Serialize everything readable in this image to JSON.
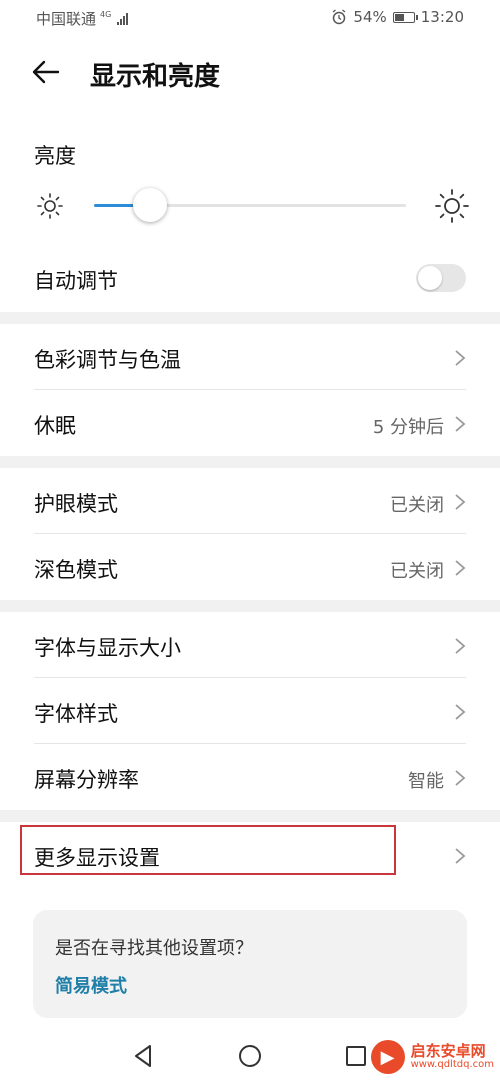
{
  "status_bar": {
    "carrier": "中国联通",
    "network": "4G",
    "battery": "54%",
    "battery_level": 0.54,
    "time": "13:20"
  },
  "header": {
    "title": "显示和亮度"
  },
  "brightness": {
    "label": "亮度",
    "level": 0.18,
    "auto_label": "自动调节",
    "auto_enabled": false
  },
  "groups": [
    {
      "rows": [
        {
          "label": "色彩调节与色温",
          "value": ""
        },
        {
          "label": "休眠",
          "value": "5 分钟后"
        }
      ]
    },
    {
      "rows": [
        {
          "label": "护眼模式",
          "value": "已关闭"
        },
        {
          "label": "深色模式",
          "value": "已关闭"
        }
      ]
    },
    {
      "rows": [
        {
          "label": "字体与显示大小",
          "value": ""
        },
        {
          "label": "字体样式",
          "value": ""
        },
        {
          "label": "屏幕分辨率",
          "value": "智能"
        }
      ]
    },
    {
      "rows": [
        {
          "label": "更多显示设置",
          "value": ""
        }
      ]
    }
  ],
  "suggestion": {
    "question": "是否在寻找其他设置项？",
    "link": "简易模式"
  },
  "watermark": {
    "title": "启东安卓网",
    "url": "www.qdltdq.com"
  },
  "colors": {
    "accent": "#2f8cd6",
    "highlight": "#c8363c",
    "link": "#1f7fa8"
  }
}
